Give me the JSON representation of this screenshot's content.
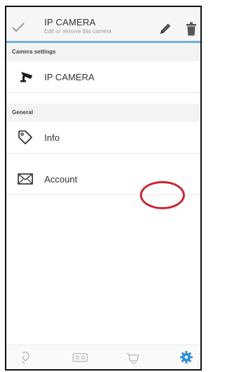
{
  "header": {
    "title": "IP CAMERA",
    "subtitle": "Edit or remove this camera"
  },
  "sections": {
    "camera_settings": "Camera settings",
    "general": "General"
  },
  "rows": {
    "camera": {
      "label": "IP CAMERA",
      "icon": "cctv-camera-icon"
    },
    "info": {
      "label": "Info",
      "icon": "tag-icon"
    },
    "account": {
      "label": "Account",
      "icon": "envelope-icon"
    }
  },
  "bottom_tabs": [
    {
      "icon": "lightbulb-icon"
    },
    {
      "icon": "cassette-icon"
    },
    {
      "icon": "cart-icon"
    },
    {
      "icon": "gear-icon",
      "active": true
    }
  ],
  "colors": {
    "accent": "#6fb1dd",
    "active_tab": "#2e8fd6",
    "annotation": "#cc2630"
  }
}
